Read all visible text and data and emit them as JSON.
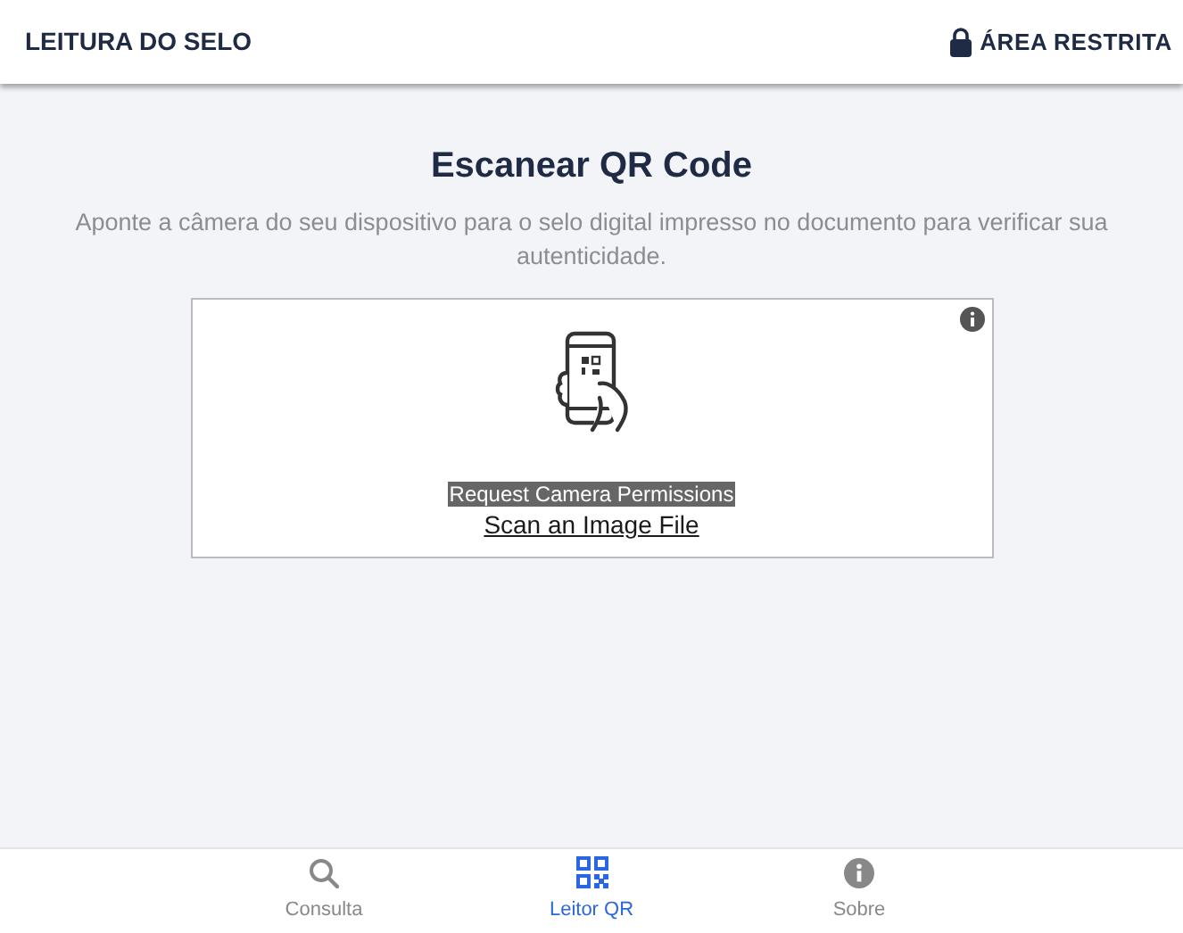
{
  "header": {
    "title": "LEITURA DO SELO",
    "restricted_link": "ÁREA RESTRITA"
  },
  "main": {
    "title": "Escanear QR Code",
    "description": "Aponte a câmera do seu dispositivo para o selo digital impresso no documento para verificar sua autenticidade."
  },
  "scanner": {
    "permission_button": "Request Camera Permissions",
    "file_link": "Scan an Image File"
  },
  "bottom_nav": [
    {
      "label": "Consulta",
      "kind": "search",
      "selected": false
    },
    {
      "label": "Leitor QR",
      "kind": "qr",
      "selected": true
    },
    {
      "label": "Sobre",
      "kind": "info",
      "selected": false
    }
  ]
}
